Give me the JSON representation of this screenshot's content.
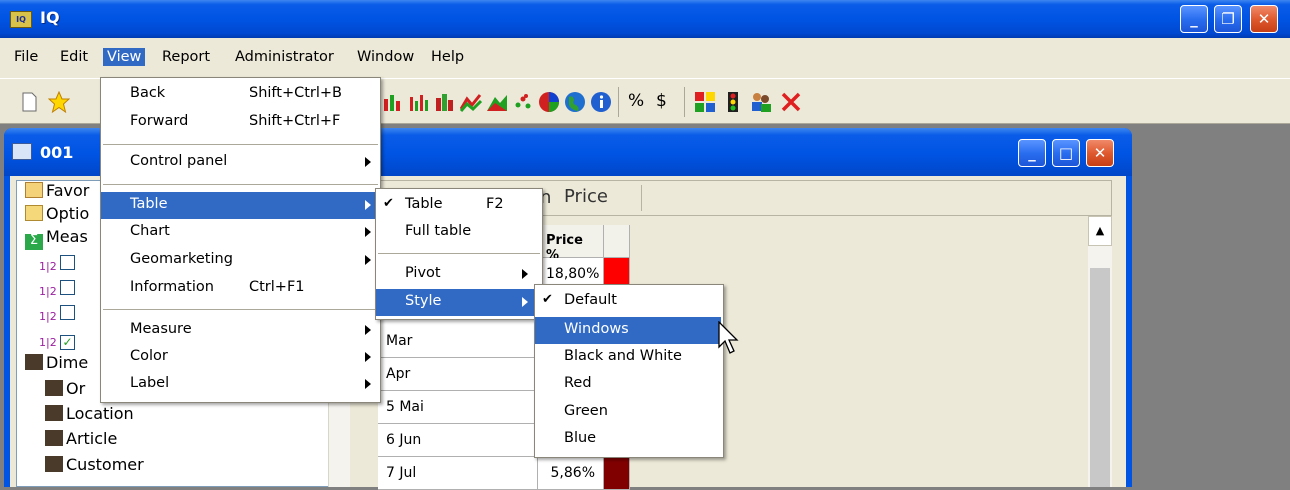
{
  "window": {
    "title": "IQ",
    "icon": "app-icon",
    "minimize": "_",
    "maximize": "❐",
    "close": "✕"
  },
  "menubar": [
    "File",
    "Edit",
    "View",
    "Report",
    "Administrator",
    "Window",
    "Help"
  ],
  "toolbar": {
    "percent": "%",
    "currency": "$"
  },
  "inner_window": {
    "title": "001",
    "minimize": "_",
    "maximize": "□",
    "close": "✕"
  },
  "tree": {
    "items": [
      {
        "label": "Favor",
        "icon": "favorites-icon"
      },
      {
        "label": "Optio",
        "icon": "folder-icon"
      },
      {
        "label": "Meas",
        "icon": "sum-icon"
      },
      {
        "label": "",
        "icon": "measure-icon"
      },
      {
        "label": "",
        "icon": "measure-icon"
      },
      {
        "label": "",
        "icon": "measure-icon"
      },
      {
        "label": "",
        "icon": "measure-icon"
      },
      {
        "label": "Dime",
        "icon": "dimension-icon"
      },
      {
        "label": "Or",
        "icon": "dimension-icon"
      },
      {
        "label": "Location",
        "icon": "dimension-icon"
      },
      {
        "label": "Article",
        "icon": "dimension-icon"
      },
      {
        "label": "Customer",
        "icon": "dimension-icon"
      }
    ]
  },
  "table": {
    "header_tab_fragment": "n",
    "header_tab": "Price",
    "column_header": "Price %",
    "rows": [
      {
        "label": "",
        "value": "18,80%",
        "color": "#ff0000"
      },
      {
        "label": "Mar",
        "value": "",
        "color": ""
      },
      {
        "label": "Apr",
        "value": "",
        "color": ""
      },
      {
        "label": "5 Mai",
        "value": "",
        "color": ""
      },
      {
        "label": "6 Jun",
        "value": "",
        "color": ""
      },
      {
        "label": "7 Jul",
        "value": "5,86%",
        "color": "#800000"
      }
    ]
  },
  "view_menu": {
    "items": [
      {
        "label": "Back",
        "shortcut": "Shift+Ctrl+B"
      },
      {
        "label": "Forward",
        "shortcut": "Shift+Ctrl+F"
      },
      {
        "label": "Control panel",
        "submenu": true
      },
      {
        "label": "Table",
        "submenu": true,
        "highlighted": true
      },
      {
        "label": "Chart",
        "submenu": true
      },
      {
        "label": "Geomarketing",
        "submenu": true
      },
      {
        "label": "Information",
        "shortcut": "Ctrl+F1"
      },
      {
        "label": "Measure",
        "submenu": true
      },
      {
        "label": "Color",
        "submenu": true
      },
      {
        "label": "Label",
        "submenu": true
      }
    ]
  },
  "table_menu": {
    "items": [
      {
        "label": "Table",
        "shortcut": "F2",
        "checked": true
      },
      {
        "label": "Full table"
      },
      {
        "label": "Pivot",
        "submenu": true
      },
      {
        "label": "Style",
        "submenu": true,
        "highlighted": true
      }
    ]
  },
  "style_menu": {
    "items": [
      {
        "label": "Default",
        "checked": true
      },
      {
        "label": "Windows",
        "highlighted": true
      },
      {
        "label": "Black and White"
      },
      {
        "label": "Red"
      },
      {
        "label": "Green"
      },
      {
        "label": "Blue"
      }
    ]
  },
  "colors": {
    "xp_blue": "#0054e3",
    "highlight": "#316ac5",
    "face": "#ece9d8"
  }
}
